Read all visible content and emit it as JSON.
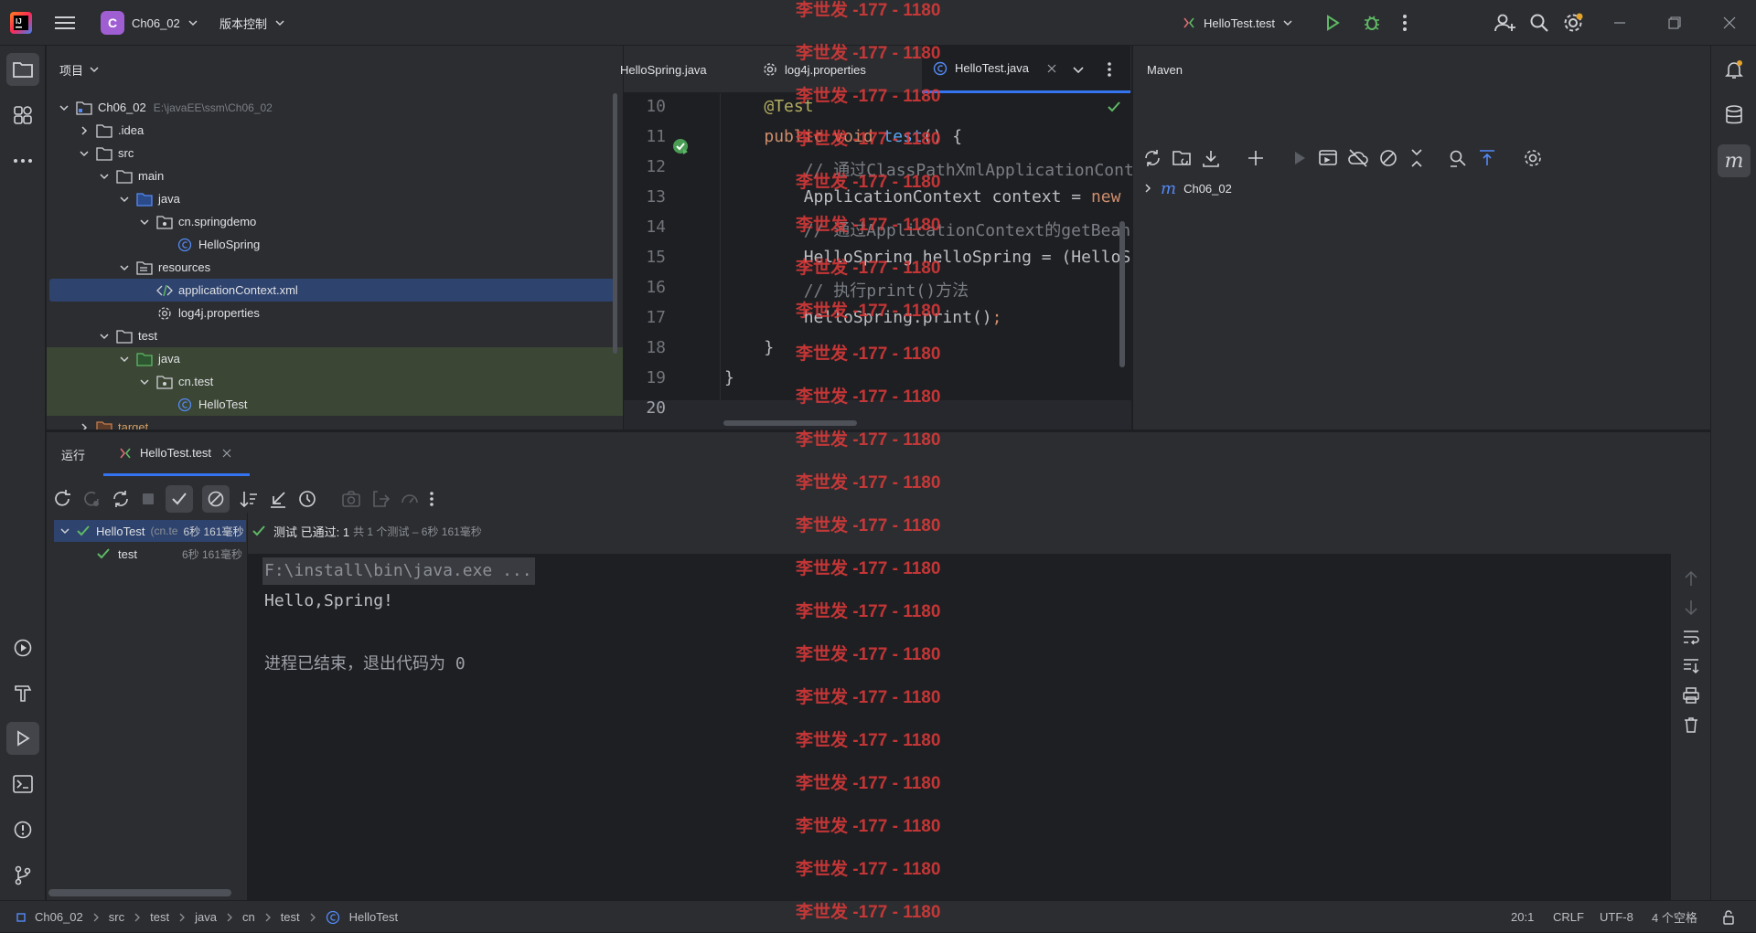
{
  "titlebar": {
    "project_letter": "C",
    "project_name": "Ch06_02",
    "vcs_label": "版本控制",
    "run_config": "HelloTest.test"
  },
  "project_panel": {
    "title": "项目",
    "tree": [
      {
        "label": "Ch06_02",
        "hint": "E:\\javaEE\\ssm\\Ch06_02",
        "depth": 0,
        "expanded": true,
        "kind": "module"
      },
      {
        "label": ".idea",
        "depth": 1,
        "expanded": false,
        "kind": "folder"
      },
      {
        "label": "src",
        "depth": 1,
        "expanded": true,
        "kind": "folder"
      },
      {
        "label": "main",
        "depth": 2,
        "expanded": true,
        "kind": "folder"
      },
      {
        "label": "java",
        "depth": 3,
        "expanded": true,
        "kind": "src-folder"
      },
      {
        "label": "cn.springdemo",
        "depth": 4,
        "expanded": true,
        "kind": "package"
      },
      {
        "label": "HelloSpring",
        "depth": 5,
        "kind": "class"
      },
      {
        "label": "resources",
        "depth": 3,
        "expanded": true,
        "kind": "res-folder"
      },
      {
        "label": "applicationContext.xml",
        "depth": 4,
        "kind": "xml",
        "selected": true
      },
      {
        "label": "log4j.properties",
        "depth": 4,
        "kind": "props"
      },
      {
        "label": "test",
        "depth": 2,
        "expanded": true,
        "kind": "folder"
      },
      {
        "label": "java",
        "depth": 3,
        "expanded": true,
        "kind": "test-folder",
        "tinted": true
      },
      {
        "label": "cn.test",
        "depth": 4,
        "expanded": true,
        "kind": "package",
        "tinted": true
      },
      {
        "label": "HelloTest",
        "depth": 5,
        "kind": "class",
        "tinted": true
      },
      {
        "label": "target",
        "depth": 1,
        "expanded": false,
        "kind": "target-folder"
      }
    ]
  },
  "editor": {
    "tabs": [
      {
        "label": "HelloSpring.java"
      },
      {
        "label": "log4j.properties"
      },
      {
        "label": "HelloTest.java",
        "active": true
      }
    ],
    "lines": [
      {
        "num": "10",
        "text": "    @Test"
      },
      {
        "num": "11",
        "text": "    public void test() {"
      },
      {
        "num": "12",
        "text": "        // 通过ClassPathXmlApplicationCont"
      },
      {
        "num": "13",
        "text": "        ApplicationContext context = new "
      },
      {
        "num": "14",
        "text": "        // 通过ApplicationContext的getBean"
      },
      {
        "num": "15",
        "text": "        HelloSpring helloSpring = (HelloS"
      },
      {
        "num": "16",
        "text": "        // 执行print()方法"
      },
      {
        "num": "17",
        "text": "        helloSpring.print();"
      },
      {
        "num": "18",
        "text": "    }"
      },
      {
        "num": "19",
        "text": "}"
      },
      {
        "num": "20",
        "text": ""
      }
    ]
  },
  "maven": {
    "title": "Maven",
    "project": "Ch06_02"
  },
  "run": {
    "tab_label": "运行",
    "config_tab": "HelloTest.test",
    "status": "测试 已通过: 1",
    "status_detail": "共 1 个测试 – 6秒 161毫秒",
    "tree": [
      {
        "label": "HelloTest",
        "sub": "(cn.te",
        "time": "6秒 161毫秒"
      },
      {
        "label": "test",
        "time": "6秒 161毫秒"
      }
    ],
    "console": [
      "F:\\install\\bin\\java.exe ...",
      "Hello,Spring!",
      "",
      "进程已结束，退出代码为 0"
    ]
  },
  "statusbar": {
    "breadcrumbs": [
      "Ch06_02",
      "src",
      "test",
      "java",
      "cn",
      "test",
      "HelloTest"
    ],
    "position": "20:1",
    "line_sep": "CRLF",
    "encoding": "UTF-8",
    "indent": "4 个空格"
  },
  "watermark": "李世发 -177 - 1180",
  "colors": {
    "accent": "#3574f0",
    "pass_green": "#5fb865",
    "keyword": "#cf8e6d",
    "annotation": "#b3ae60",
    "method": "#56a8f5",
    "watermark": "#e13a3a"
  }
}
